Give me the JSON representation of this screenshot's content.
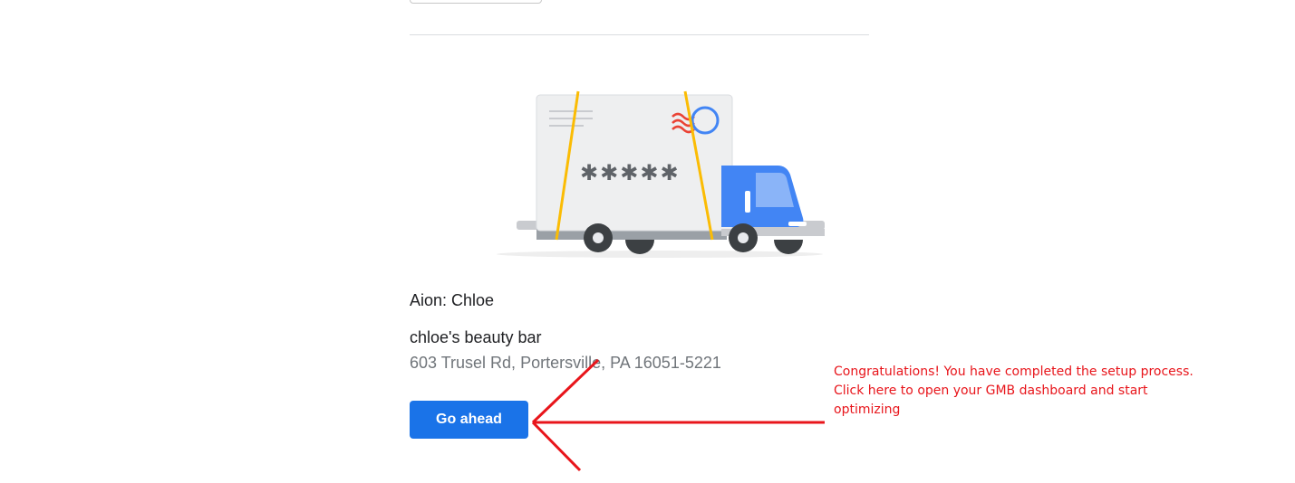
{
  "business": {
    "account_label": "Aion: Chloe",
    "name": "chloe's beauty bar",
    "address": "603 Trusel Rd, Portersville, PA 16051-5221"
  },
  "actions": {
    "go_ahead_label": "Go ahead"
  },
  "illustration": {
    "postcard_code": "✱✱✱✱✱"
  },
  "annotation": {
    "lines": [
      "Congratulations! You have completed the setup process.",
      "Click here to open your GMB dashboard and start",
      "optimizing"
    ]
  },
  "colors": {
    "primary_button": "#1a73e8",
    "annotation": "#e8151b",
    "truck_blue": "#4285f4",
    "strap_yellow": "#fbbc04"
  }
}
